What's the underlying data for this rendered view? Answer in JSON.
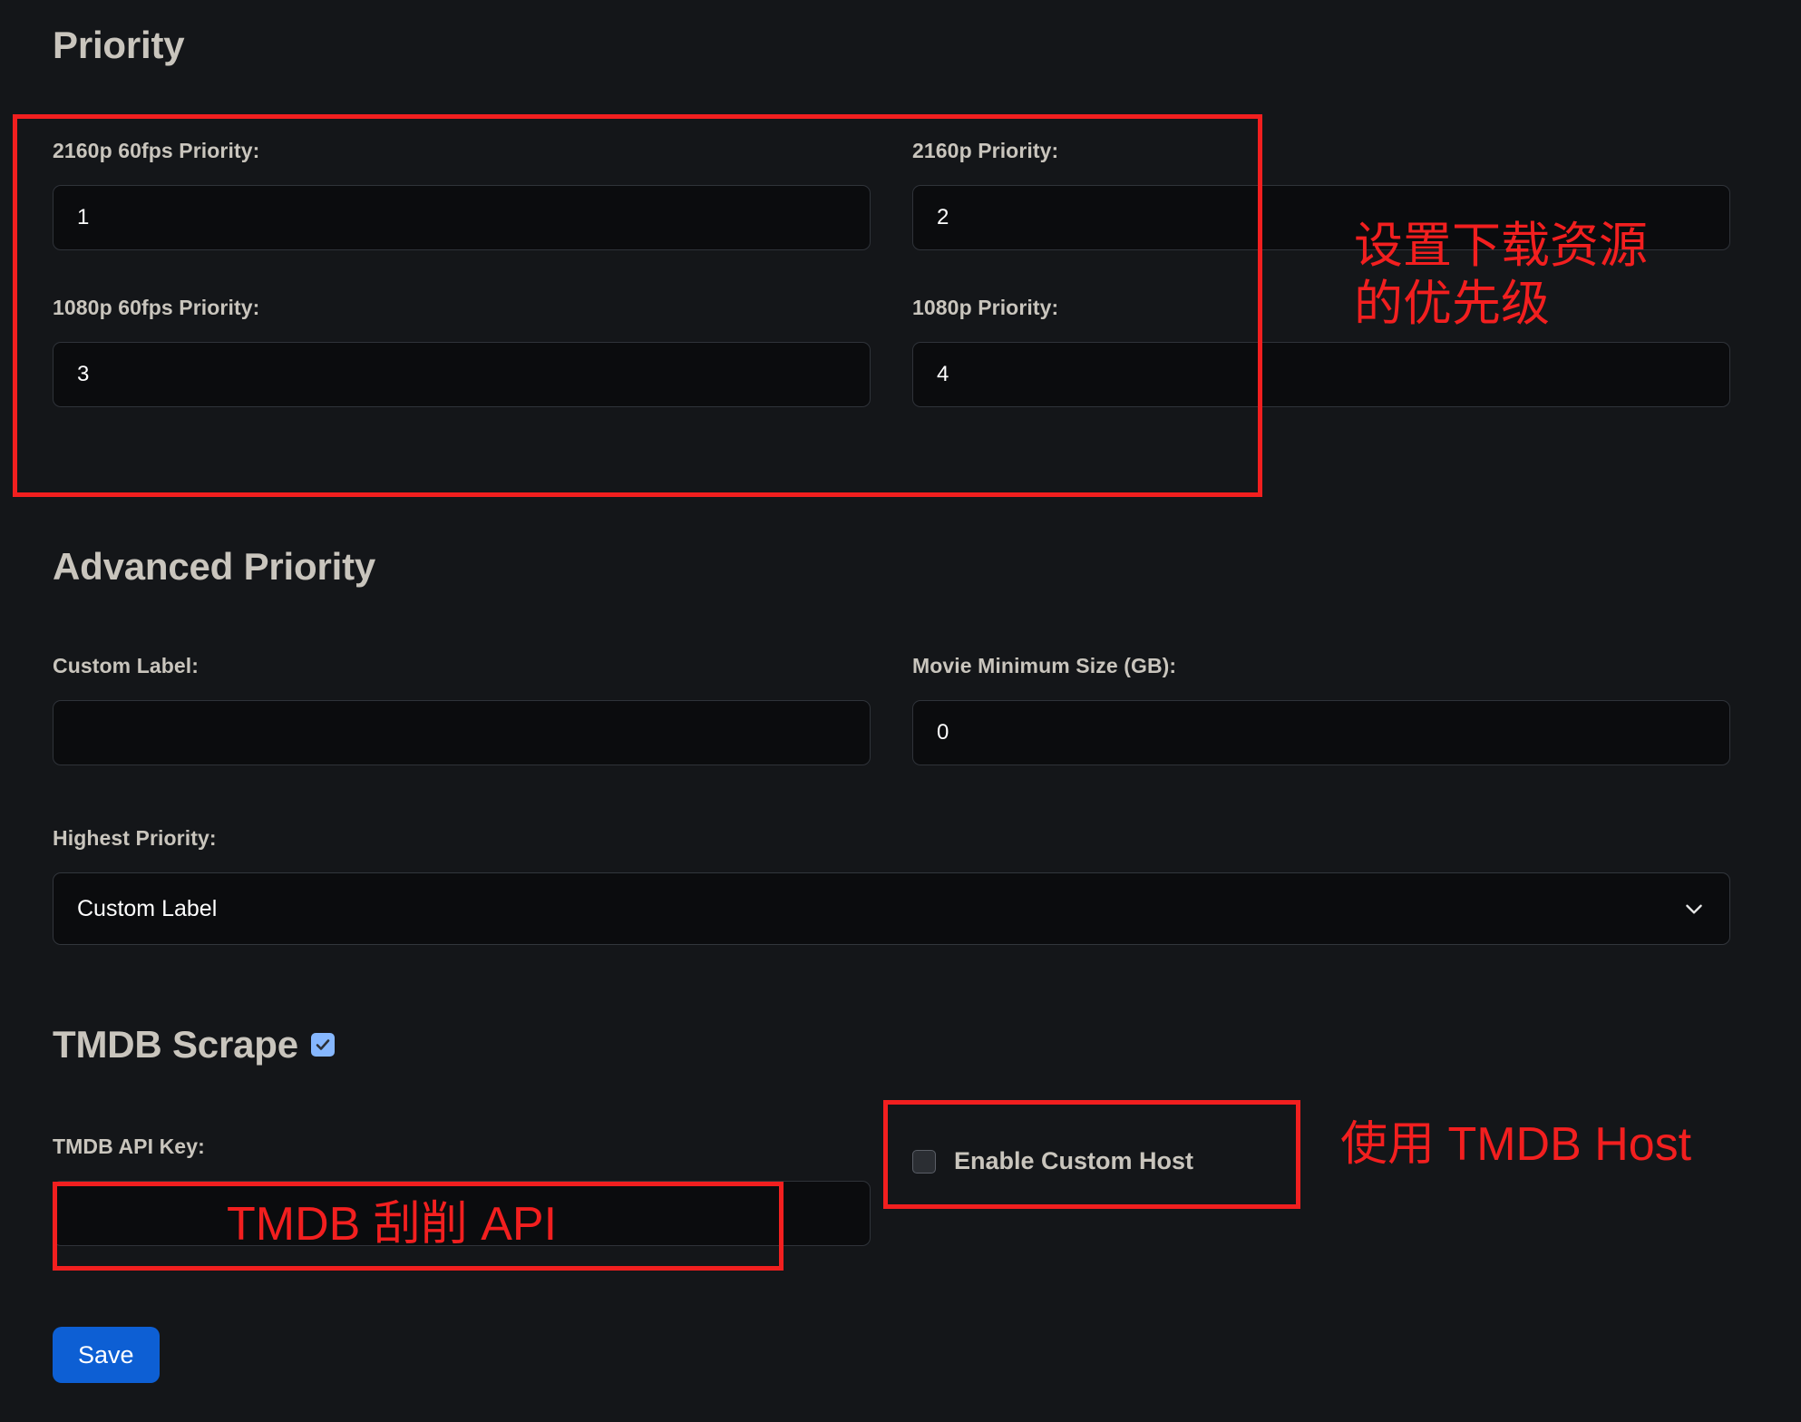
{
  "theme": {
    "background": "#141619",
    "input_background": "#0b0c0e",
    "heading_color": "#c9c5bd",
    "accent_blue": "#0d5fd4",
    "checkbox_checked": "#86b7fe",
    "annotation_red": "#f21f1f"
  },
  "priority_section": {
    "heading": "Priority",
    "fields": [
      {
        "label": "2160p 60fps Priority:",
        "value": "1"
      },
      {
        "label": "2160p Priority:",
        "value": "2"
      },
      {
        "label": "1080p 60fps Priority:",
        "value": "3"
      },
      {
        "label": "1080p Priority:",
        "value": "4"
      }
    ]
  },
  "advanced_section": {
    "heading": "Advanced Priority",
    "custom_label": {
      "label": "Custom Label:",
      "value": ""
    },
    "movie_min_size": {
      "label": "Movie Minimum Size (GB):",
      "value": "0"
    },
    "highest_priority": {
      "label": "Highest Priority:",
      "selected": "Custom Label",
      "chevron_icon": "chevron-down-icon"
    }
  },
  "tmdb_section": {
    "heading": "TMDB Scrape",
    "heading_checkbox": {
      "checked": true,
      "icon": "checkmark-icon"
    },
    "api_key": {
      "label": "TMDB API Key:",
      "value": ""
    },
    "custom_host": {
      "label": "Enable Custom Host",
      "checked": false
    }
  },
  "actions": {
    "save_label": "Save"
  },
  "annotations": [
    {
      "id": "ann-priority-text",
      "text": "设置下载资源\n的优先级"
    },
    {
      "id": "ann-api-text",
      "text": "TMDB 刮削 API"
    },
    {
      "id": "ann-host-text",
      "text": "使用 TMDB Host"
    }
  ]
}
